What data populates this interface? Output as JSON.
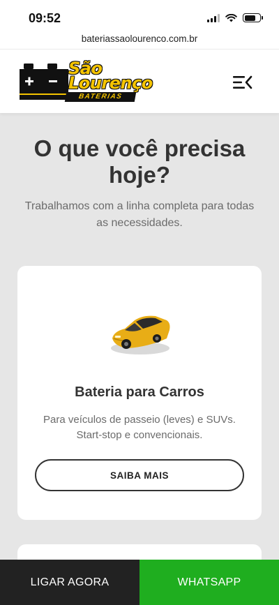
{
  "status_bar": {
    "time": "09:52",
    "icons": [
      "signal-icon",
      "wifi-icon",
      "battery-icon"
    ]
  },
  "browser": {
    "url": "bateriassaolourenco.com.br"
  },
  "header": {
    "logo": {
      "brand": "São Lourenço",
      "tagline": "BATERIAS"
    },
    "menu_icon": "menu-icon"
  },
  "hero": {
    "title": "O que você precisa hoje?",
    "subtitle": "Trabalhamos com a linha completa para todas as necessidades."
  },
  "cards": [
    {
      "icon": "car-icon",
      "title": "Bateria para Carros",
      "description": "Para veículos de passeio (leves) e SUVs. Start-stop e convencionais.",
      "button_label": "SAIBA MAIS"
    }
  ],
  "bottom_bar": {
    "call_label": "LIGAR AGORA",
    "whatsapp_label": "WHATSAPP"
  },
  "colors": {
    "brand_yellow": "#f5c400",
    "whatsapp_green": "#1fae1f",
    "dark": "#222222",
    "page_background": "#e6e6e6"
  }
}
